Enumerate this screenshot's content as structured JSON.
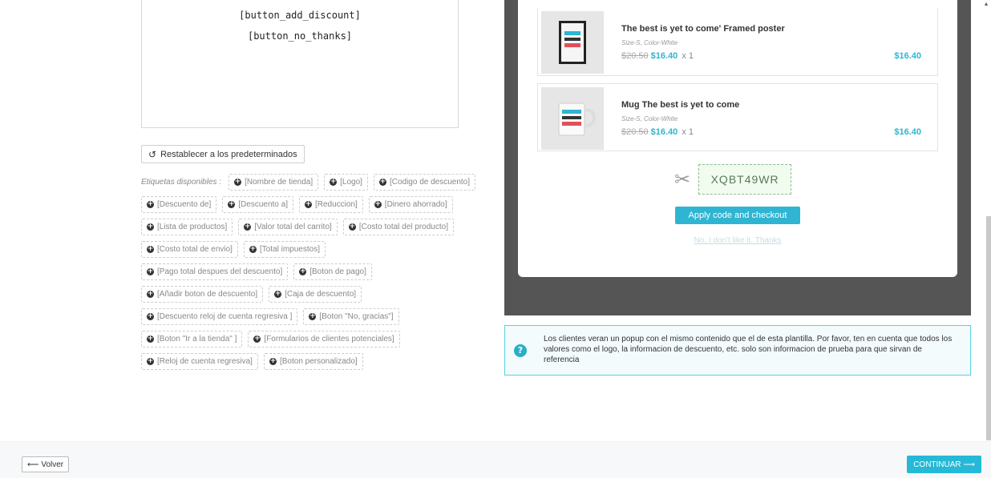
{
  "editor": {
    "shortcode_add_discount": "[button_add_discount]",
    "shortcode_no_thanks": "[button_no_thanks]"
  },
  "reset_button": {
    "icon": "undo-icon",
    "label": "Restablecer a los predeterminados"
  },
  "tags": {
    "label": "Etiquetas disponibles :",
    "items": [
      "[Nombre de tienda]",
      "[Logo]",
      "[Codigo de descuento]",
      "[Descuento de]",
      "[Descuento a]",
      "[Reduccion]",
      "[Dinero ahorrado]",
      "[Lista de productos]",
      "[Valor total del carrito]",
      "[Costo total del producto]",
      "[Costo total de envio]",
      "[Total impuestos]",
      "[Pago total despues del descuento]",
      "[Boton de pago]",
      "[Añadir boton de descuento]",
      "[Caja de descuento]",
      "[Descuento reloj de cuenta regresiva ]",
      "[Boton \"No, gracias\"]",
      "[Boton \"Ir a la tienda\" ]",
      "[Formularios de clientes potenciales]",
      "[Reloj de cuenta regresiva]",
      "[Boton personalizado]"
    ]
  },
  "preview": {
    "products": [
      {
        "name": "The best is yet to come' Framed poster",
        "attrs": "Size-S, Color-White",
        "old_price": "$20.50",
        "new_price": "$16.40",
        "qty": "x 1",
        "total": "$16.40"
      },
      {
        "name": "Mug The best is yet to come",
        "attrs": "Size-S, Color-White",
        "old_price": "$20.50",
        "new_price": "$16.40",
        "qty": "x 1",
        "total": "$16.40"
      }
    ],
    "discount_code": "XQBT49WR",
    "apply_button": "Apply code and checkout",
    "no_thanks_link": "No, I don't like it. Thanks"
  },
  "info": {
    "icon": "question-icon",
    "text": "Los clientes veran un popup con el mismo contenido que el de esta plantilla. Por favor, ten en cuenta que todos los valores como el logo, la informacion de descuento, etc. solo son informacion de prueba para que sirvan de referencia"
  },
  "footer": {
    "back_label": "Volver",
    "continue_label": "CONTINUAR"
  },
  "colors": {
    "accent": "#25b9d7",
    "preview_bg": "#555555",
    "info_border": "#5ccfe0"
  }
}
